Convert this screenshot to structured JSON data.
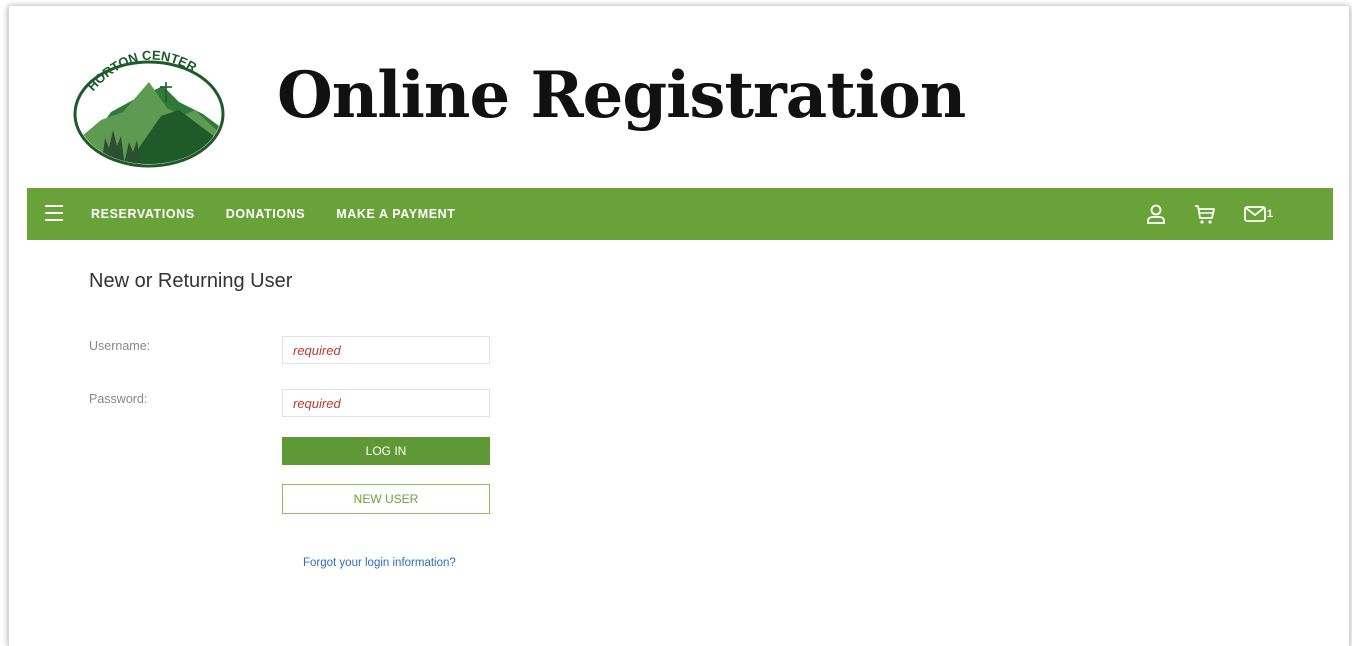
{
  "header": {
    "logo_text": "HORTON CENTER",
    "title": "Online Registration"
  },
  "nav": {
    "items": [
      {
        "label": "RESERVATIONS"
      },
      {
        "label": "DONATIONS"
      },
      {
        "label": "MAKE A PAYMENT"
      }
    ],
    "icons": [
      "menu-icon",
      "user-icon",
      "cart-icon",
      "mail-icon"
    ],
    "mail_count": "1"
  },
  "login": {
    "heading": "New or Returning User",
    "username_label": "Username:",
    "username_placeholder": "required",
    "password_label": "Password:",
    "password_placeholder": "required",
    "login_button": "LOG IN",
    "new_user_button": "NEW USER",
    "forgot_link": "Forgot your login information?"
  },
  "colors": {
    "nav_green": "#6aa23a",
    "button_green": "#5f9935",
    "required_red": "#c0392b",
    "link_blue": "#2d6cc0",
    "logo_green": "#1f5a2b"
  }
}
